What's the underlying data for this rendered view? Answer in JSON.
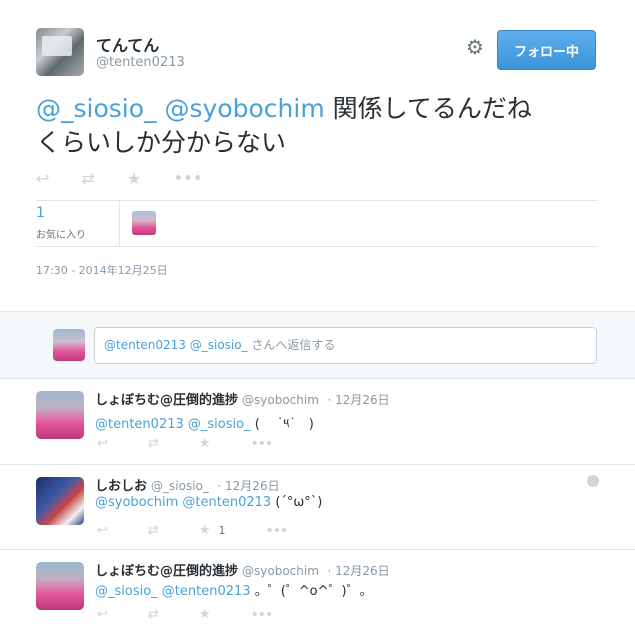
{
  "tweet": {
    "name": "てんてん",
    "handle": "@tenten0213",
    "follow_label": "フォロー中",
    "mention1": "@_siosio_",
    "mention2": "@syobochim",
    "text_line1_rest": " 関係してるんだね",
    "text_line2": "くらいしか分からない",
    "fav_count": "1",
    "fav_label": "お気に入り",
    "timestamp": "17:30 - 2014年12月25日"
  },
  "reply_box": {
    "placeholder_mentions": "@tenten0213 @_siosio_",
    "placeholder_suffix": " さんへ返信する"
  },
  "replies": [
    {
      "name": "しょぼちむ@圧倒的進捗",
      "handle": "@syobochim",
      "date": "· 12月26日",
      "mentions": "@tenten0213 @_siosio_",
      "text": " (　 ˙༥˙　)",
      "fav_count": ""
    },
    {
      "name": "しおしお",
      "handle": "@_siosio_",
      "date": "· 12月26日",
      "mentions": "@syobochim @tenten0213",
      "text": " (ˊ°ω°ˋ)",
      "fav_count": "1"
    },
    {
      "name": "しょぼちむ@圧倒的進捗",
      "handle": "@syobochim",
      "date": "· 12月26日",
      "mentions": "@_siosio_ @tenten0213",
      "text": " 。゜(゜^o^゜)゜。",
      "fav_count": ""
    }
  ],
  "icons": [
    "gear-icon",
    "reply-icon",
    "retweet-icon",
    "favorite-icon",
    "more-icon",
    "globe-icon"
  ],
  "colors": {
    "link": "#4aa0d8",
    "follow_button": "#3b94d9",
    "muted": "#8899a6"
  }
}
